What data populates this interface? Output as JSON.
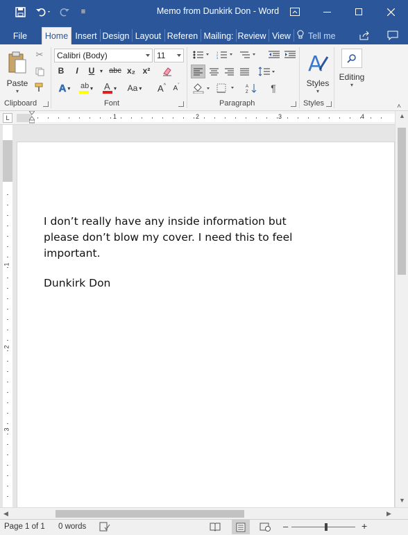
{
  "window": {
    "title": "Memo from Dunkirk Don  -  Word",
    "save_icon": "save-icon",
    "undo_icon": "undo-icon",
    "redo_icon": "redo-icon"
  },
  "tabs": [
    {
      "label": "File"
    },
    {
      "label": "Home"
    },
    {
      "label": "Insert"
    },
    {
      "label": "Design"
    },
    {
      "label": "Layout"
    },
    {
      "label": "Referen"
    },
    {
      "label": "Mailing:"
    },
    {
      "label": "Review"
    },
    {
      "label": "View"
    }
  ],
  "tell_me": "Tell me",
  "ribbon": {
    "paste_label": "Paste",
    "clipboard_label": "Clipboard",
    "font_name": "Calibri (Body)",
    "font_size": "11",
    "font_label": "Font",
    "paragraph_label": "Paragraph",
    "styles_button": "Styles",
    "styles_label": "Styles",
    "editing_button": "Editing",
    "bold": "B",
    "italic": "I",
    "underline": "U",
    "strike": "abc",
    "subscript": "x₂",
    "superscript": "x²",
    "text_effects": "A",
    "font_color": "A",
    "change_case": "Aa",
    "grow_font": "A",
    "shrink_font": "A",
    "pilcrow": "¶"
  },
  "ruler": {
    "corner": "L",
    "h_numbers": [
      "1",
      "2",
      "3",
      "4"
    ],
    "v_numbers": [
      "1",
      "2",
      "3"
    ]
  },
  "document": {
    "body": "I don’t really have any inside information but please don’t blow my cover. I need this to feel important.",
    "signature": "Dunkirk Don"
  },
  "status": {
    "page": "Page 1 of 1",
    "words": "0 words",
    "zoom_minus": "–",
    "zoom_plus": "+"
  },
  "colors": {
    "accent": "#2b579a",
    "highlight": "#ffff00",
    "font_color": "#e02020"
  }
}
